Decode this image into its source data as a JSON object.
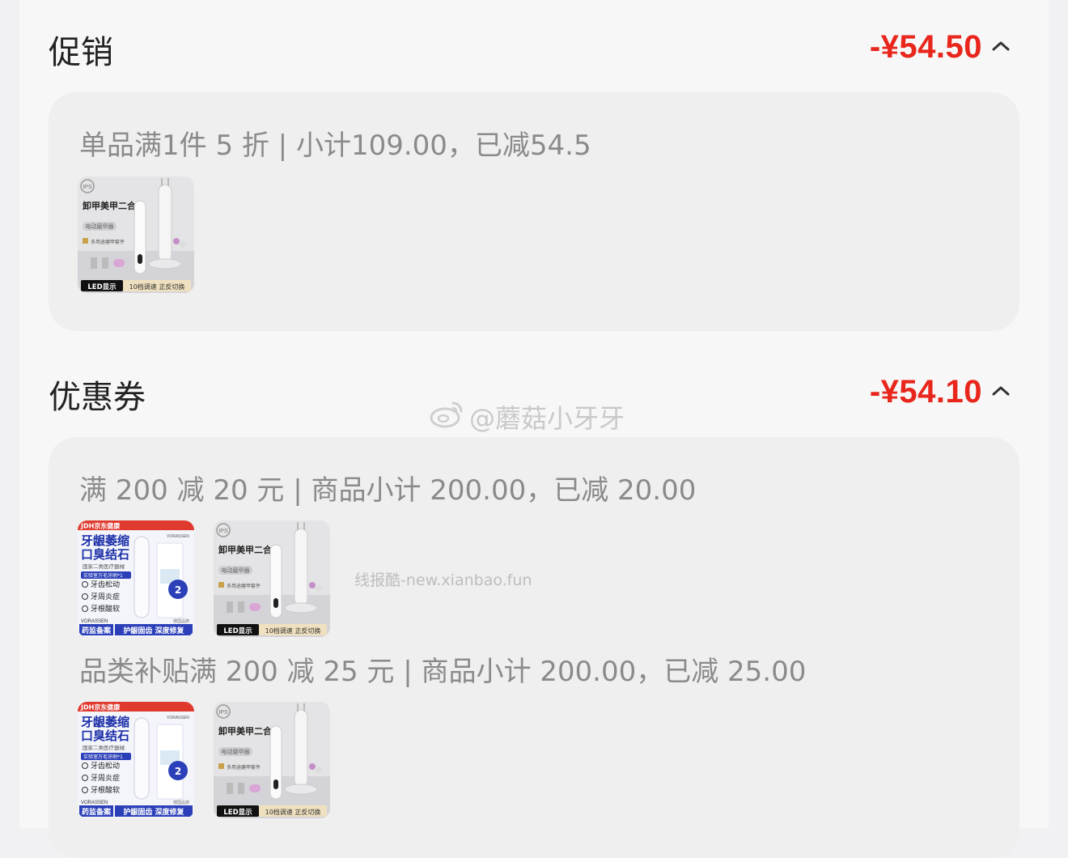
{
  "promotion": {
    "title": "促销",
    "amount": "-¥54.50",
    "rule": "单品满1件 5 折 | 小计109.00，已减54.5",
    "products": [
      {
        "name": "卸甲美甲二合一",
        "sub": "电动磨甲器",
        "badge": "LED显示",
        "tag": "10档调速 正反切换",
        "logo": "IPS",
        "label": "多用途磨甲套件"
      }
    ]
  },
  "coupons": {
    "title": "优惠券",
    "amount": "-¥54.10",
    "rules": [
      {
        "text": "满 200 减 20 元 | 商品小计 200.00，已减 20.00"
      },
      {
        "text": "品类补贴满 200 减 25 元 | 商品小计 200.00，已减 25.00"
      }
    ],
    "product_toothbrush": {
      "brand": "JDH京东健康",
      "brand2": "VORASSEN",
      "headline1": "牙龈萎缩",
      "headline2": "口臭结石",
      "cert": "国家二类医疗器械",
      "highlight": "实验室万毛牙刷*1",
      "points": [
        "牙齿松动",
        "牙周炎症",
        "牙根酸软"
      ],
      "badge": "2支装",
      "bottom1": "药监备案",
      "bottom2": "护龈固齿 深度修复",
      "bottom3": "德国品牌"
    },
    "product_nail": {
      "name": "卸甲美甲二合一",
      "sub": "电动磨甲器",
      "badge": "LED显示",
      "tag": "10档调速 正反切换",
      "logo": "IPS",
      "label": "多用途磨甲套件"
    }
  },
  "watermarks": {
    "weibo": "@蘑菇小牙牙",
    "site": "线报酷-new.xianbao.fun"
  }
}
